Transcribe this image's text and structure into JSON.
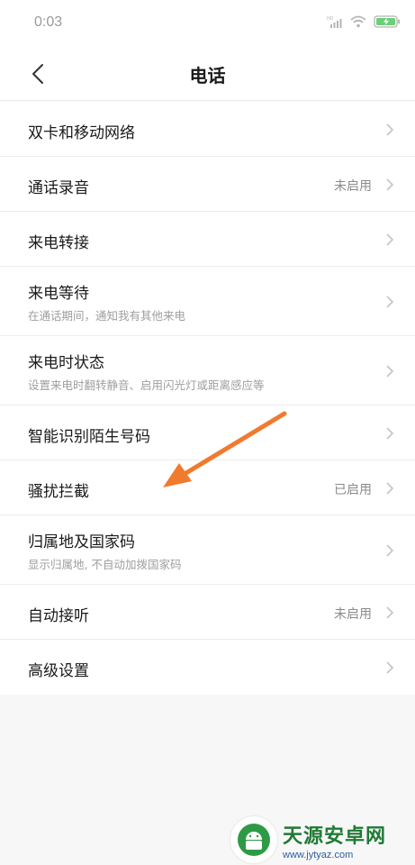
{
  "status_bar": {
    "time": "0:03",
    "icons": [
      "hd-signal-icon",
      "wifi-icon",
      "battery-charging-icon"
    ]
  },
  "header": {
    "title": "电话",
    "back_icon": "chevron-left-icon"
  },
  "rows": [
    {
      "title": "双卡和移动网络",
      "subtitle": "",
      "value": ""
    },
    {
      "title": "通话录音",
      "subtitle": "",
      "value": "未启用"
    },
    {
      "title": "来电转接",
      "subtitle": "",
      "value": ""
    },
    {
      "title": "来电等待",
      "subtitle": "在通话期间，通知我有其他来电",
      "value": ""
    },
    {
      "title": "来电时状态",
      "subtitle": "设置来电时翻转静音、启用闪光灯或距离感应等",
      "value": ""
    },
    {
      "title": "智能识别陌生号码",
      "subtitle": "",
      "value": ""
    },
    {
      "title": "骚扰拦截",
      "subtitle": "",
      "value": "已启用"
    },
    {
      "title": "归属地及国家码",
      "subtitle": "显示归属地, 不自动加拨国家码",
      "value": ""
    },
    {
      "title": "自动接听",
      "subtitle": "",
      "value": "未启用"
    },
    {
      "title": "高级设置",
      "subtitle": "",
      "value": ""
    }
  ],
  "colors": {
    "annotation_arrow": "#f07a2e",
    "watermark_green": "#1f7a34",
    "watermark_blue": "#2d5e9e"
  },
  "watermark": {
    "name": "天源安卓网",
    "url": "www.jytyaz.com"
  }
}
